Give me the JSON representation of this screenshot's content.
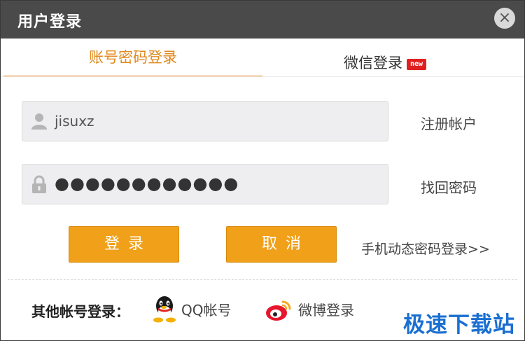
{
  "window": {
    "title": "用户登录",
    "close_glyph": "×"
  },
  "tabs": [
    {
      "label": "账号密码登录",
      "active": true
    },
    {
      "label": "微信登录",
      "badge": "new",
      "active": false
    }
  ],
  "username": {
    "value": "jisuxz",
    "icon": "user-icon"
  },
  "password": {
    "value": "●●●●●●●●●●●●",
    "icon": "lock-icon"
  },
  "links": {
    "register": "注册帐户",
    "recover": "找回密码",
    "phone_login": "手机动态密码登录>>"
  },
  "buttons": {
    "login": "登录",
    "cancel": "取消"
  },
  "other": {
    "label": "其他帐号登录：",
    "qq": "QQ帐号",
    "weibo": "微博登录"
  },
  "watermark": "极速下载站",
  "colors": {
    "accent": "#f08522",
    "button": "#f0a019",
    "titlebar": "#4a4a4a",
    "badge": "#e02020",
    "watermark": "#1a6fd0"
  }
}
